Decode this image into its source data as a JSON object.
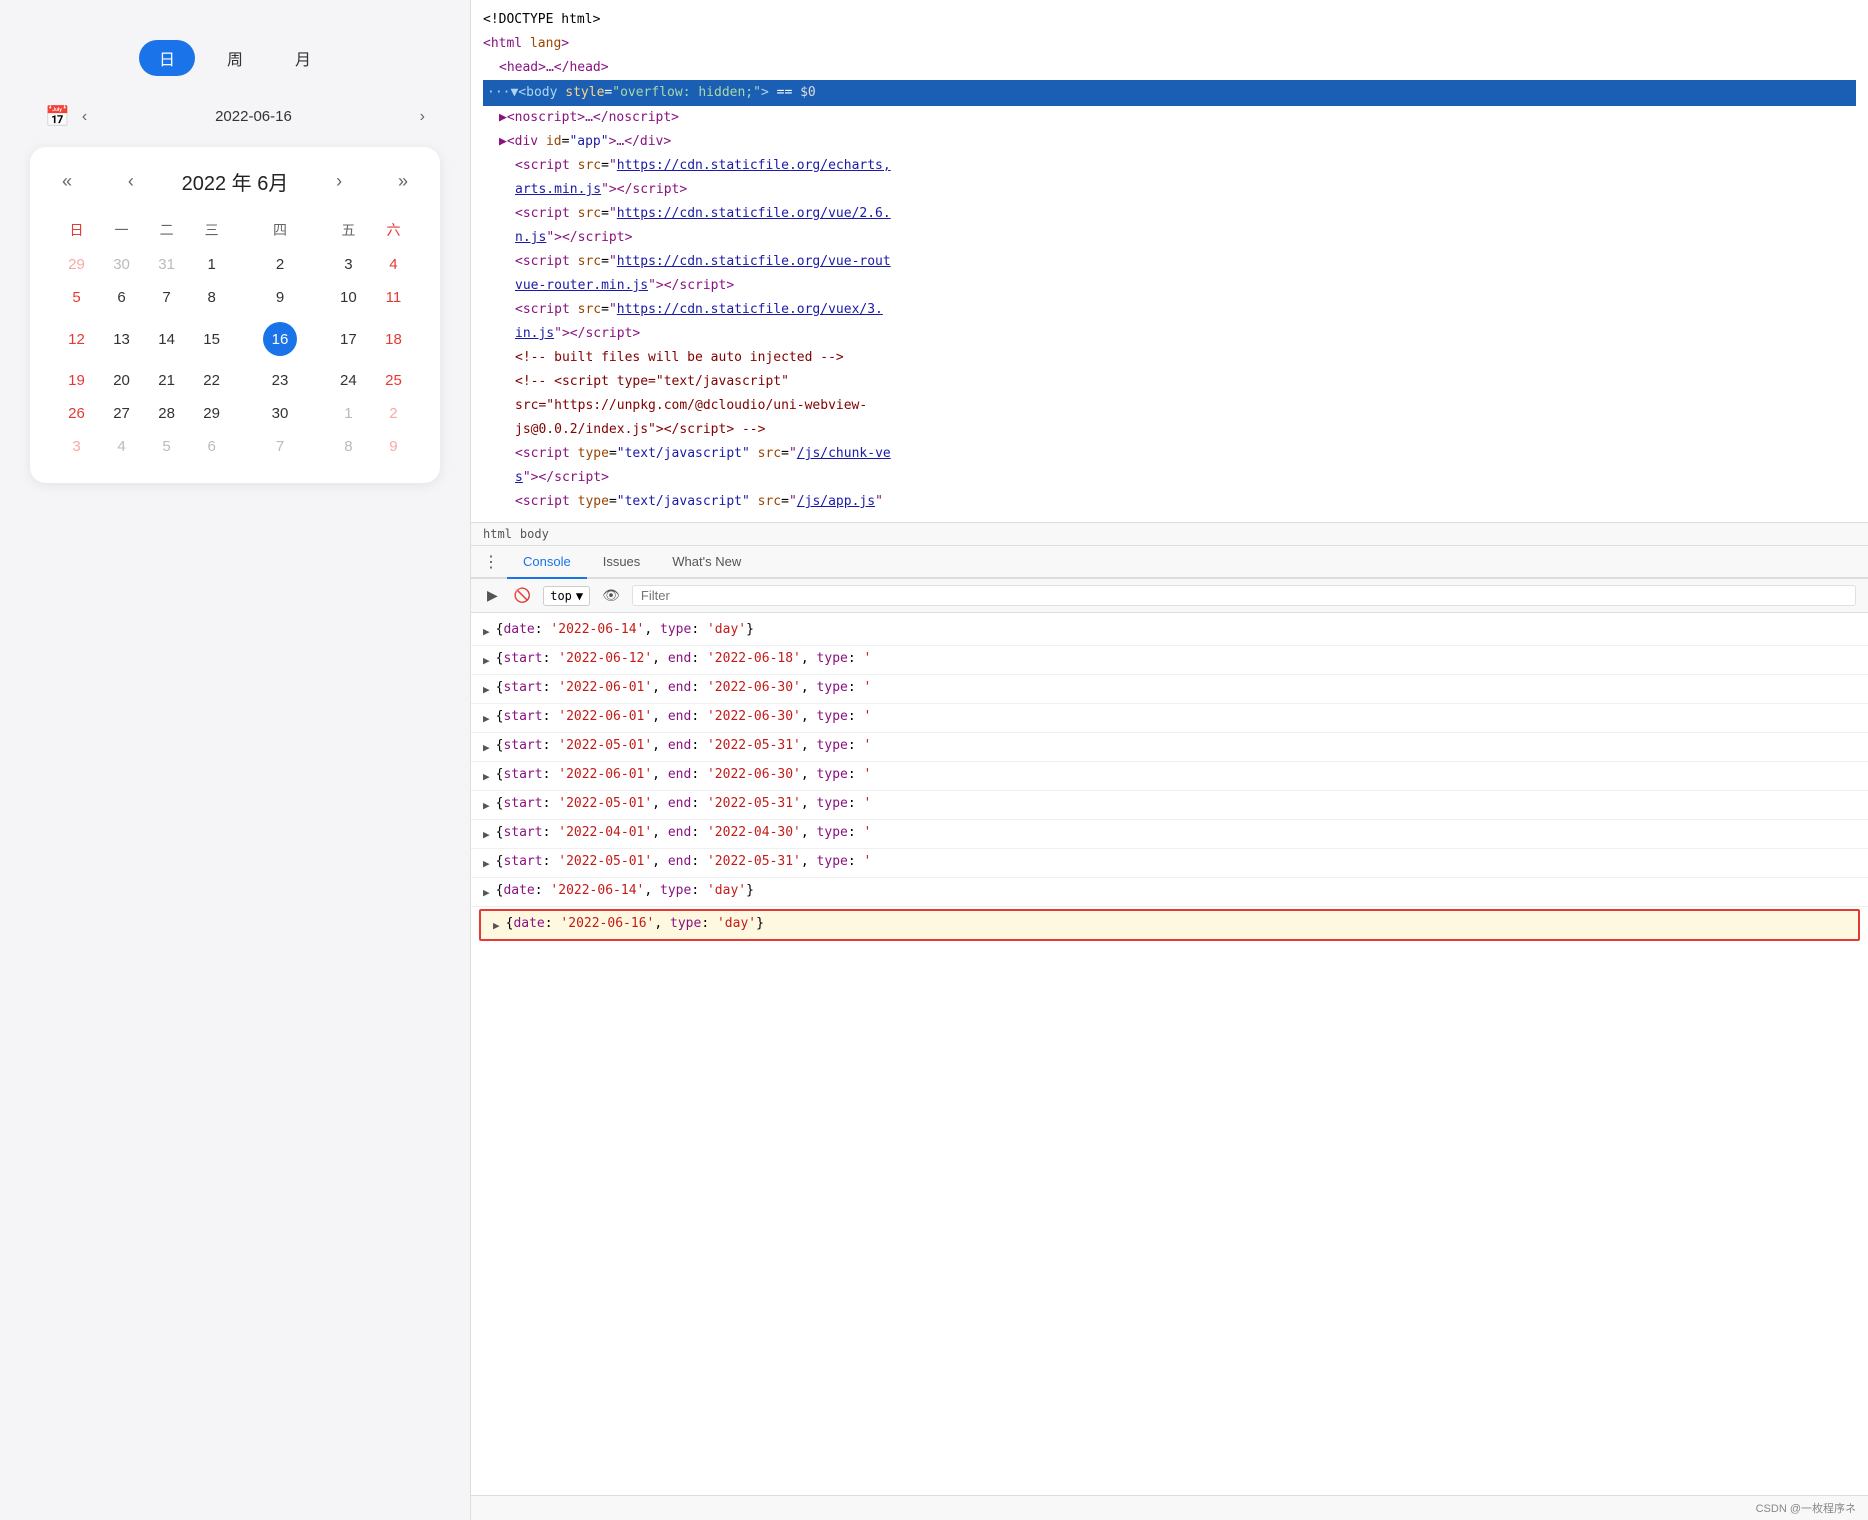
{
  "left": {
    "view_toggle": {
      "buttons": [
        {
          "label": "日",
          "active": true
        },
        {
          "label": "周",
          "active": false
        },
        {
          "label": "月",
          "active": false
        }
      ]
    },
    "date_input": {
      "value": "2022-06-16",
      "prev_label": "‹",
      "calendar_icon": "📅"
    },
    "calendar": {
      "title": "2022 年 6月",
      "prev_year": "«",
      "prev_month": "‹",
      "next_month": "›",
      "next_year": "»",
      "weekdays": [
        "日",
        "一",
        "二",
        "三",
        "四",
        "五",
        "六"
      ],
      "weeks": [
        [
          {
            "day": "29",
            "other": true,
            "weekend": true
          },
          {
            "day": "30",
            "other": true
          },
          {
            "day": "31",
            "other": true
          },
          {
            "day": "1",
            "other": false
          },
          {
            "day": "2",
            "other": false
          },
          {
            "day": "3",
            "other": false
          },
          {
            "day": "4",
            "other": false,
            "weekend": true
          }
        ],
        [
          {
            "day": "5",
            "other": false,
            "weekend": true
          },
          {
            "day": "6",
            "other": false
          },
          {
            "day": "7",
            "other": false
          },
          {
            "day": "8",
            "other": false
          },
          {
            "day": "9",
            "other": false
          },
          {
            "day": "10",
            "other": false
          },
          {
            "day": "11",
            "other": false,
            "weekend": true
          }
        ],
        [
          {
            "day": "12",
            "other": false,
            "weekend": true
          },
          {
            "day": "13",
            "other": false
          },
          {
            "day": "14",
            "other": false
          },
          {
            "day": "15",
            "other": false
          },
          {
            "day": "16",
            "other": false,
            "today": true
          },
          {
            "day": "17",
            "other": false
          },
          {
            "day": "18",
            "other": false,
            "weekend": true
          }
        ],
        [
          {
            "day": "19",
            "other": false,
            "weekend": true
          },
          {
            "day": "20",
            "other": false
          },
          {
            "day": "21",
            "other": false
          },
          {
            "day": "22",
            "other": false
          },
          {
            "day": "23",
            "other": false
          },
          {
            "day": "24",
            "other": false
          },
          {
            "day": "25",
            "other": false,
            "weekend": true
          }
        ],
        [
          {
            "day": "26",
            "other": false,
            "weekend": true
          },
          {
            "day": "27",
            "other": false
          },
          {
            "day": "28",
            "other": false
          },
          {
            "day": "29",
            "other": false
          },
          {
            "day": "30",
            "other": false
          },
          {
            "day": "1",
            "other": true
          },
          {
            "day": "2",
            "other": true,
            "weekend": true
          }
        ],
        [
          {
            "day": "3",
            "other": true,
            "weekend": true
          },
          {
            "day": "4",
            "other": true
          },
          {
            "day": "5",
            "other": true
          },
          {
            "day": "6",
            "other": true
          },
          {
            "day": "7",
            "other": true
          },
          {
            "day": "8",
            "other": true
          },
          {
            "day": "9",
            "other": true,
            "weekend": true
          }
        ]
      ]
    }
  },
  "right": {
    "elements": [
      {
        "indent": 0,
        "html": "&lt;!DOCTYPE html&gt;",
        "type": "comment"
      },
      {
        "indent": 0,
        "html": "<span class='tag'>&lt;html</span> <span class='attr-name'>lang</span><span class='tag'>&gt;</span>",
        "type": "element"
      },
      {
        "indent": 1,
        "html": "<span class='tag'>&lt;head&gt;…&lt;/head&gt;</span>",
        "type": "element"
      },
      {
        "indent": 0,
        "html": "<span class='tag'>···▼&lt;body</span> <span class='attr-name'>style</span>=<span class='attr-value'>\"overflow: hidden;\"</span><span class='tag'>&gt;</span> == <span class='dollar-sign'>$0</span>",
        "type": "selected"
      },
      {
        "indent": 1,
        "html": "<span class='tag'>▶&lt;noscript&gt;…&lt;/noscript&gt;</span>",
        "type": "element"
      },
      {
        "indent": 1,
        "html": "<span class='tag'>▶&lt;div</span> <span class='attr-name'>id</span>=<span class='attr-value'>\"app\"</span><span class='tag'>&gt;…&lt;/div&gt;</span>",
        "type": "element"
      },
      {
        "indent": 2,
        "html": "<span class='tag'>&lt;script</span> <span class='attr-name'>src</span>=<span class='tag'>\"</span><span class='link-text'>https://cdn.staticfile.org/echarts,</span>",
        "type": "element"
      },
      {
        "indent": 2,
        "html": "<span class='link-text'>arts.min.js</span><span class='tag'>\"&gt;&lt;/script&gt;</span>",
        "type": "element"
      },
      {
        "indent": 2,
        "html": "<span class='tag'>&lt;script</span> <span class='attr-name'>src</span>=<span class='tag'>\"</span><span class='link-text'>https://cdn.staticfile.org/vue/2.6.</span>",
        "type": "element"
      },
      {
        "indent": 2,
        "html": "<span class='link-text'>n.js</span><span class='tag'>\"&gt;&lt;/script&gt;</span>",
        "type": "element"
      },
      {
        "indent": 2,
        "html": "<span class='tag'>&lt;script</span> <span class='attr-name'>src</span>=<span class='tag'>\"</span><span class='link-text'>https://cdn.staticfile.org/vue-rout</span>",
        "type": "element"
      },
      {
        "indent": 2,
        "html": "<span class='link-text'>vue-router.min.js</span><span class='tag'>\"&gt;&lt;/script&gt;</span>",
        "type": "element"
      },
      {
        "indent": 2,
        "html": "<span class='tag'>&lt;script</span> <span class='attr-name'>src</span>=<span class='tag'>\"</span><span class='link-text'>https://cdn.staticfile.org/vuex/3.</span>",
        "type": "element"
      },
      {
        "indent": 2,
        "html": "<span class='link-text'>in.js</span><span class='tag'>\"&gt;&lt;/script&gt;</span>",
        "type": "element"
      },
      {
        "indent": 2,
        "html": "<span class='comment-text'>&lt;!-- built files will be auto injected --&gt;</span>",
        "type": "comment"
      },
      {
        "indent": 2,
        "html": "<span class='comment-text'>&lt;!-- &lt;script type=\"text/javascript\"</span>",
        "type": "comment"
      },
      {
        "indent": 2,
        "html": "<span class='comment-text'>src=\"https://unpkg.com/@dcloudio/uni-webview-</span>",
        "type": "comment"
      },
      {
        "indent": 2,
        "html": "<span class='comment-text'>js@0.0.2/index.js\"&gt;&lt;/script&gt; --&gt;</span>",
        "type": "comment"
      },
      {
        "indent": 2,
        "html": "<span class='tag'>&lt;script</span> <span class='attr-name'>type</span>=<span class='attr-value'>\"text/javascript\"</span> <span class='attr-name'>src</span>=<span class='tag'>\"</span><span class='link-text'>/js/chunk-ve</span>",
        "type": "element"
      },
      {
        "indent": 2,
        "html": "<span class='link-text'>s</span><span class='tag'>\"&gt;&lt;/script&gt;</span>",
        "type": "element"
      },
      {
        "indent": 2,
        "html": "<span class='tag'>&lt;script</span> <span class='attr-name'>type</span>=<span class='attr-value'>\"text/javascript\"</span> <span class='attr-name'>src</span>=<span class='tag'>\"</span><span class='link-text'>/js/app.js</span><span class='tag'>\"</span>",
        "type": "element"
      }
    ],
    "breadcrumbs": [
      "html",
      "body"
    ],
    "tabs": [
      {
        "label": "Console",
        "active": true
      },
      {
        "label": "Issues",
        "active": false
      },
      {
        "label": "What's New",
        "active": false
      }
    ],
    "toolbar": {
      "top_label": "top",
      "filter_placeholder": "Filter"
    },
    "console_lines": [
      {
        "text": "▶ {date: <span class='console-string'>'2022-06-14'</span>, type: <span class='console-string'>'day'</span>}",
        "highlighted": false
      },
      {
        "text": "▶ {start: <span class='console-string'>'2022-06-12'</span>, end: <span class='console-string'>'2022-06-18'</span>, type: <span class='console-string'>'</span>",
        "highlighted": false
      },
      {
        "text": "▶ {start: <span class='console-string'>'2022-06-01'</span>, end: <span class='console-string'>'2022-06-30'</span>, type: <span class='console-string'>'</span>",
        "highlighted": false
      },
      {
        "text": "▶ {start: <span class='console-string'>'2022-06-01'</span>, end: <span class='console-string'>'2022-06-30'</span>, type: <span class='console-string'>'</span>",
        "highlighted": false
      },
      {
        "text": "▶ {start: <span class='console-string'>'2022-05-01'</span>, end: <span class='console-string'>'2022-05-31'</span>, type: <span class='console-string'>'</span>",
        "highlighted": false
      },
      {
        "text": "▶ {start: <span class='console-string'>'2022-06-01'</span>, end: <span class='console-string'>'2022-06-30'</span>, type: <span class='console-string'>'</span>",
        "highlighted": false
      },
      {
        "text": "▶ {start: <span class='console-string'>'2022-05-01'</span>, end: <span class='console-string'>'2022-05-31'</span>, type: <span class='console-string'>'</span>",
        "highlighted": false
      },
      {
        "text": "▶ {start: <span class='console-string'>'2022-04-01'</span>, end: <span class='console-string'>'2022-04-30'</span>, type: <span class='console-string'>'</span>",
        "highlighted": false
      },
      {
        "text": "▶ {start: <span class='console-string'>'2022-05-01'</span>, end: <span class='console-string'>'2022-05-31'</span>, type: <span class='console-string'>'</span>",
        "highlighted": false
      },
      {
        "text": "▶ {date: <span class='console-string'>'2022-06-14'</span>, type: <span class='console-string'>'day'</span>}",
        "highlighted": false
      },
      {
        "text": "▶ {date: <span class='console-string'>'2022-06-16'</span>, type: <span class='console-string'>'day'</span>}",
        "highlighted": true
      }
    ],
    "bottom_bar": "CSDN @一枚程序ネ"
  }
}
